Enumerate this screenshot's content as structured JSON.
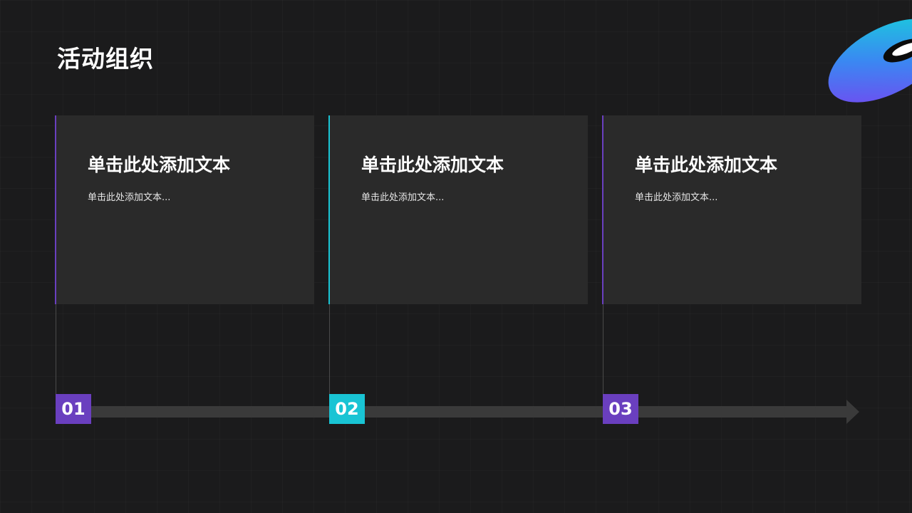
{
  "title": "活动组织",
  "colors": {
    "purple": "#6a3fbf",
    "cyan": "#19c4d4",
    "card_bg": "#2a2a2a",
    "page_bg": "#1b1b1c"
  },
  "decoration_icon": "gradient-blob-ring",
  "cards": [
    {
      "heading": "单击此处添加文本",
      "body": "单击此处添加文本...",
      "step": "01",
      "accent": "#6a3fbf"
    },
    {
      "heading": "单击此处添加文本",
      "body": "单击此处添加文本...",
      "step": "02",
      "accent": "#19c4d4"
    },
    {
      "heading": "单击此处添加文本",
      "body": "单击此处添加文本...",
      "step": "03",
      "accent": "#6a3fbf"
    }
  ]
}
